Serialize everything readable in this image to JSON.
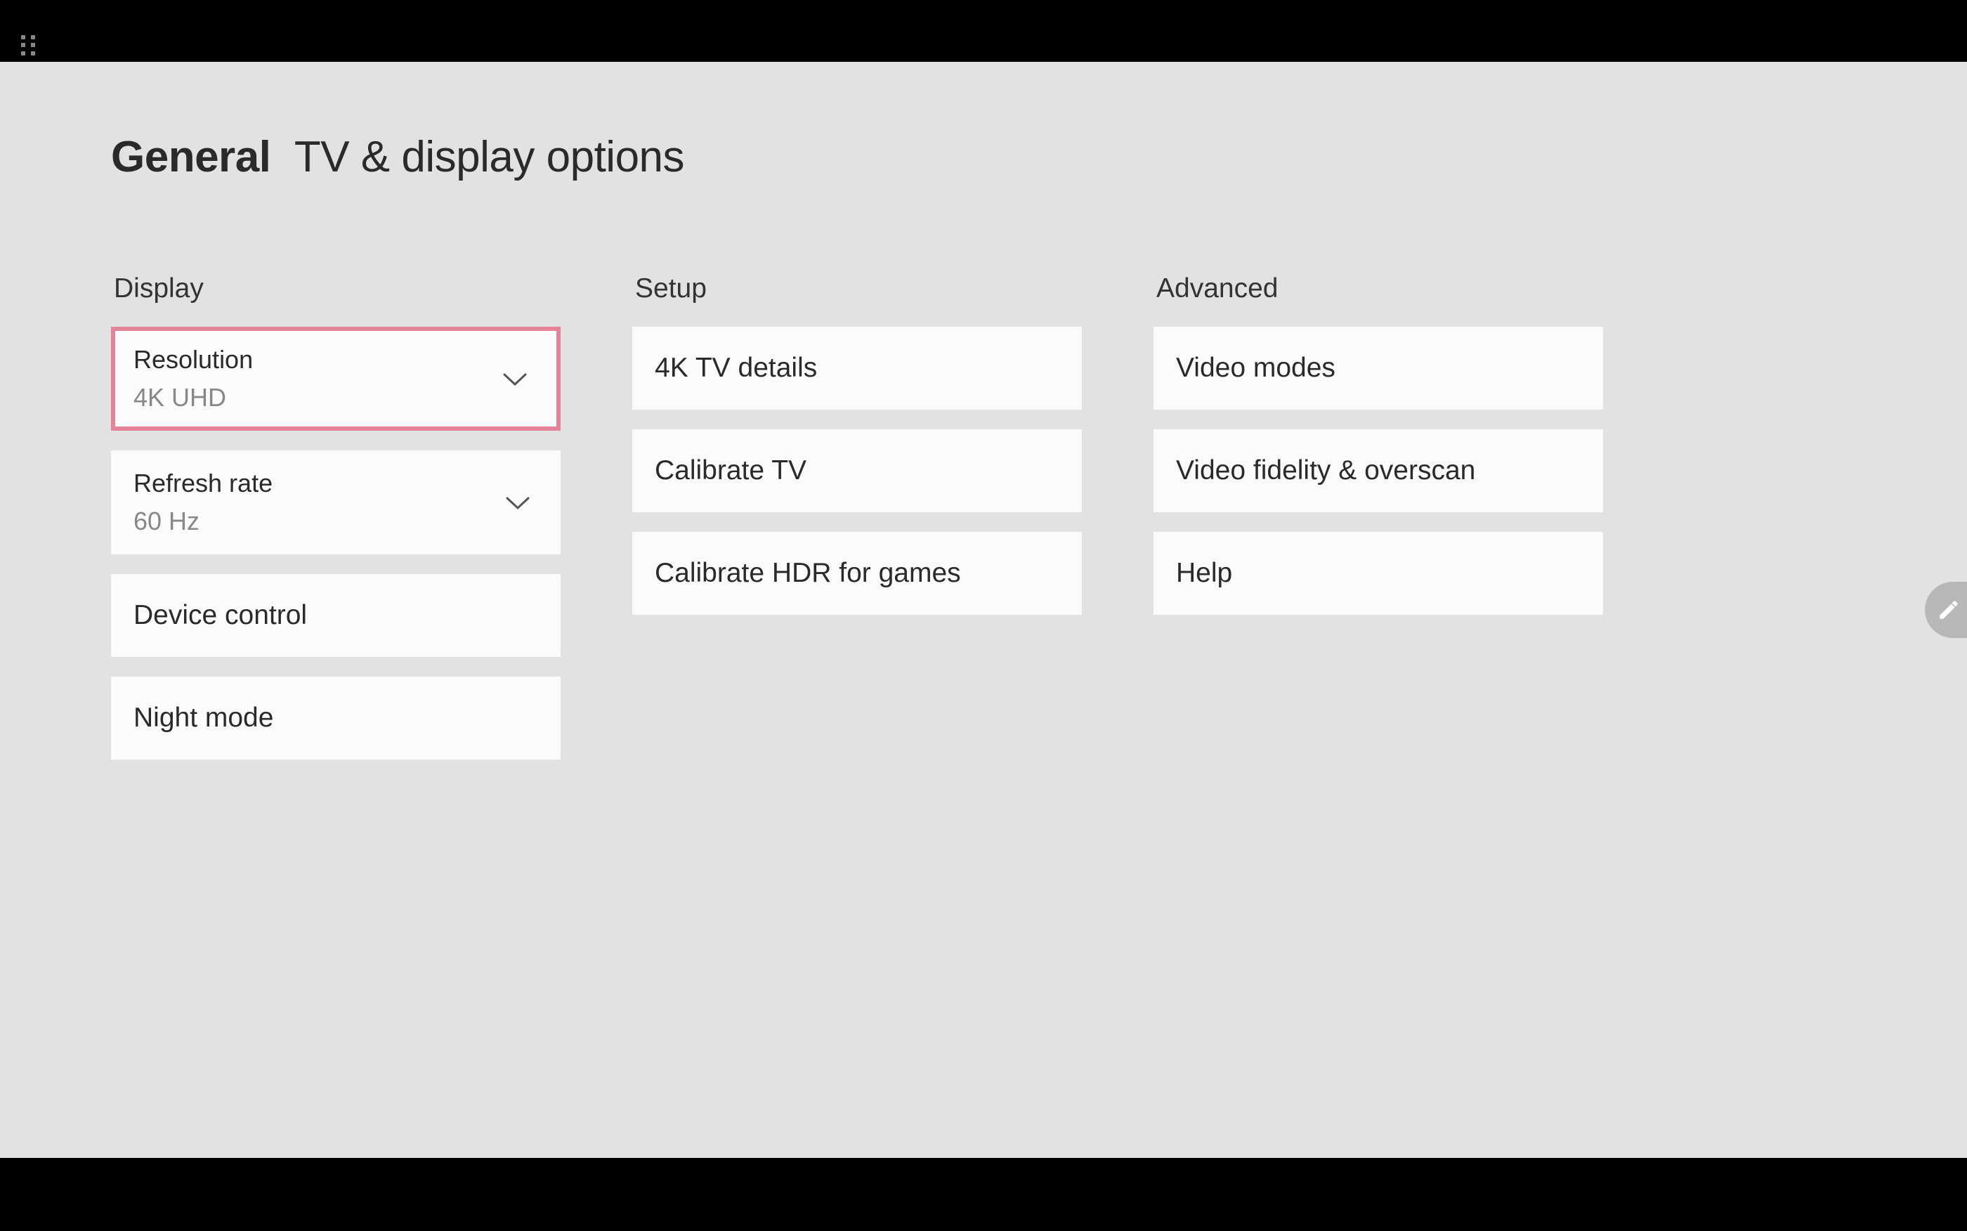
{
  "header": {
    "title_bold": "General",
    "title_rest": "TV & display options"
  },
  "columns": {
    "display": {
      "header": "Display",
      "items": [
        {
          "label": "Resolution",
          "value": "4K UHD",
          "type": "dropdown",
          "selected": true
        },
        {
          "label": "Refresh rate",
          "value": "60 Hz",
          "type": "dropdown",
          "selected": false
        },
        {
          "label": "Device control",
          "type": "button"
        },
        {
          "label": "Night mode",
          "type": "button"
        }
      ]
    },
    "setup": {
      "header": "Setup",
      "items": [
        {
          "label": "4K TV details",
          "type": "button"
        },
        {
          "label": "Calibrate TV",
          "type": "button"
        },
        {
          "label": "Calibrate HDR for games",
          "type": "button"
        }
      ]
    },
    "advanced": {
      "header": "Advanced",
      "items": [
        {
          "label": "Video modes",
          "type": "button"
        },
        {
          "label": "Video fidelity & overscan",
          "type": "button"
        },
        {
          "label": "Help",
          "type": "button"
        }
      ]
    }
  }
}
